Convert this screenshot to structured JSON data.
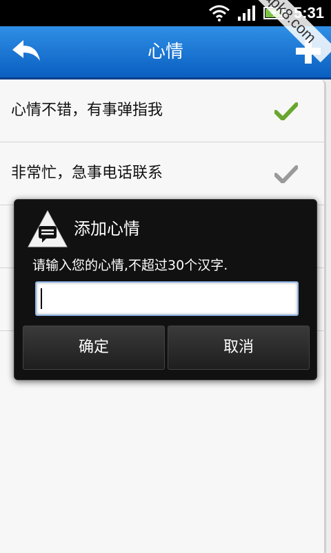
{
  "status_bar": {
    "time": "5:31"
  },
  "watermark": "apk8.com",
  "header": {
    "title": "心情"
  },
  "list": {
    "items": [
      {
        "label": "心情不错，有事弹指我",
        "checked": true
      },
      {
        "label": "非常忙，急事电话联系",
        "checked": false
      },
      {
        "label": "",
        "checked": false
      },
      {
        "label": "",
        "checked": false
      }
    ]
  },
  "dialog": {
    "title": "添加心情",
    "message": "请输入您的心情,不超过30个汉字.",
    "input_value": "",
    "ok_label": "确定",
    "cancel_label": "取消"
  },
  "colors": {
    "header_top": "#2f8fe6",
    "header_bottom": "#0a5fc0",
    "check_active": "#6aa62e",
    "check_inactive": "#9a9a9a"
  }
}
